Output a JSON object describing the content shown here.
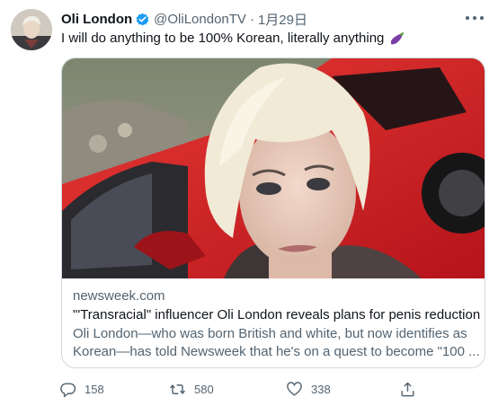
{
  "tweet": {
    "author": {
      "display_name": "Oli London",
      "handle": "@OliLondonTV",
      "separator": "·",
      "date": "1月29日",
      "verified": true
    },
    "text": "I will do anything to be 100% Korean, literally anything",
    "emoji_icon": "eggplant-icon",
    "card": {
      "domain": "newsweek.com",
      "title": "\"'Transracial\" influencer Oli London reveals plans for penis reduction ...",
      "description_line1": "Oli London—who was born British and white, but now identifies as",
      "description_line2": "Korean—has told Newsweek that he's on a quest to become \"100 ..."
    },
    "actions": {
      "reply_count": "158",
      "retweet_count": "580",
      "like_count": "338"
    },
    "icons": {
      "avatar": "avatar",
      "verified": "verified-badge-icon",
      "more": "more-options-icon",
      "reply": "reply-icon",
      "retweet": "retweet-icon",
      "like": "heart-icon",
      "share": "share-icon"
    },
    "colors": {
      "text_primary": "#0f1419",
      "text_secondary": "#536471",
      "verified_blue": "#1d9bf0",
      "border": "#cfd9de",
      "car_red": "#d31d1d"
    }
  }
}
